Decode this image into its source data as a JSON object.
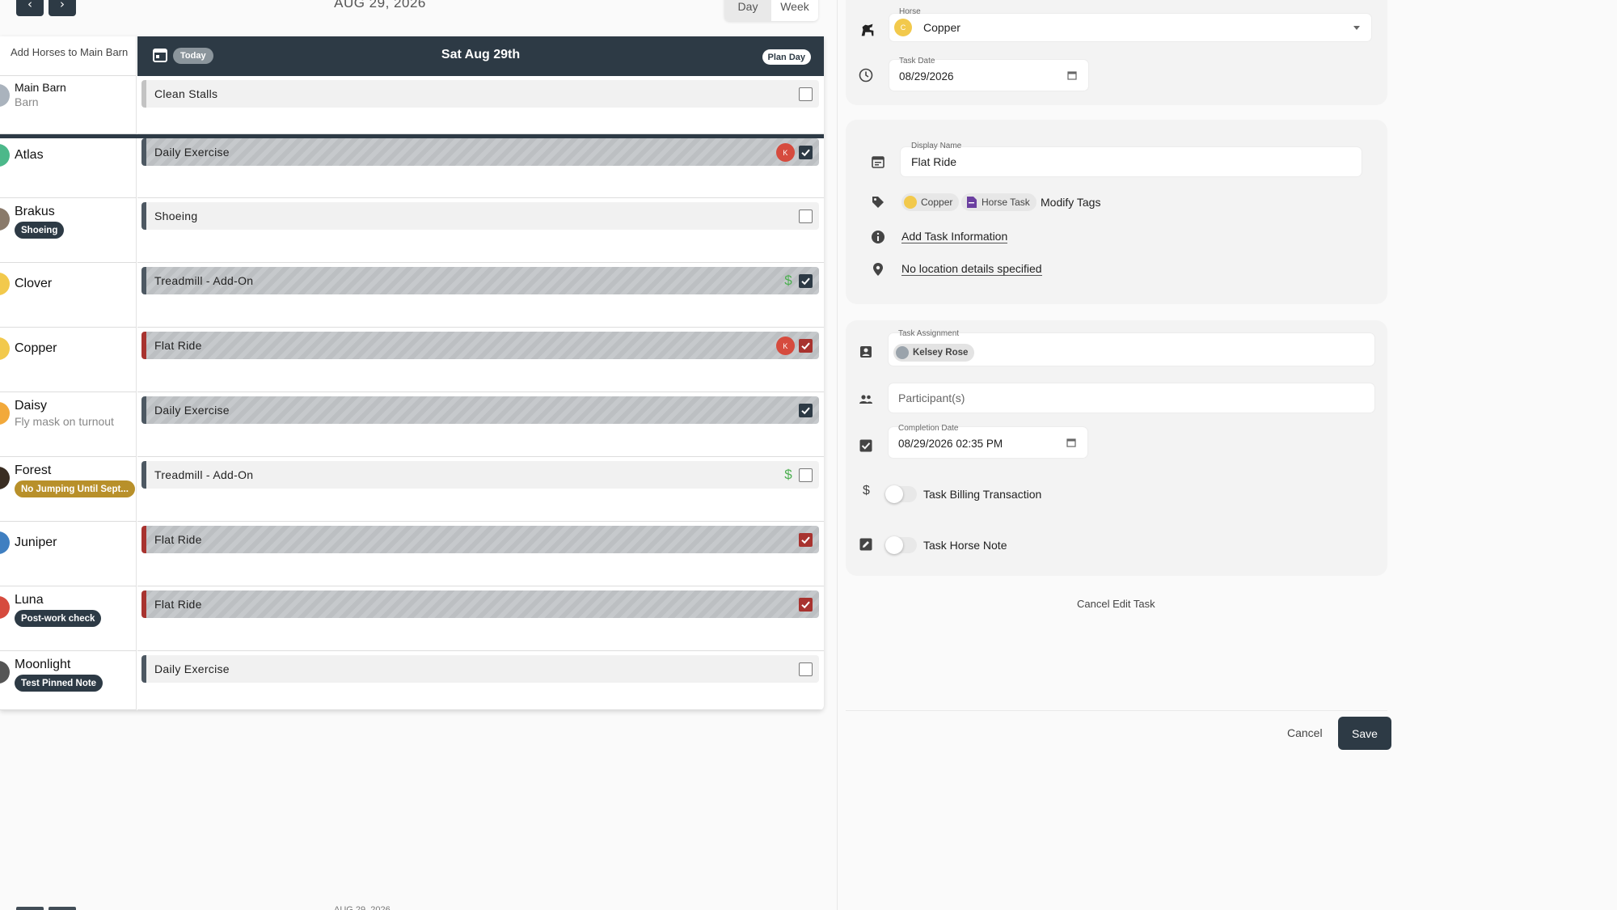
{
  "header": {
    "prev_icon": "chevron-left-icon",
    "next_icon": "chevron-right-icon",
    "date": "AUG 29, 2026",
    "view_day": "Day",
    "view_week": "Week"
  },
  "schedule": {
    "add_horses": "Add Horses to Main Barn",
    "day_label": "Sat Aug 29th",
    "today_label": "Today",
    "plan_day": "Plan Day",
    "rows": [
      {
        "name": "Main Barn",
        "sub": "Barn",
        "avatar_color": "#aab3bd",
        "task": "Clean Stalls",
        "done": false
      },
      {
        "name": "Atlas",
        "avatar_color": "#4cb88a",
        "task": "Daily Exercise",
        "done": true,
        "assignee": "K"
      },
      {
        "name": "Brakus",
        "badge": "Shoeing",
        "badge_color": "#2d3a45",
        "avatar_color": "#8a7a6a",
        "task": "Shoeing",
        "done": false
      },
      {
        "name": "Clover",
        "avatar_color": "#f2c94c",
        "task": "Treadmill - Add-On",
        "done": true,
        "billing": "$"
      },
      {
        "name": "Copper",
        "avatar_color": "#f2c94c",
        "task": "Flat Ride",
        "done": true,
        "assignee": "K"
      },
      {
        "name": "Daisy",
        "sub": "Fly mask on turnout",
        "avatar_color": "#f2a93b",
        "task": "Daily Exercise",
        "done": true
      },
      {
        "name": "Forest",
        "badge": "No Jumping Until Sept...",
        "badge_color": "#b8902a",
        "avatar_color": "#3a2d22",
        "task": "Treadmill - Add-On",
        "done": false,
        "billing": "$"
      },
      {
        "name": "Juniper",
        "avatar_color": "#3f7fc1",
        "task": "Flat Ride",
        "done": true
      },
      {
        "name": "Luna",
        "badge": "Post-work check",
        "badge_color": "#2d3a45",
        "avatar_color": "#d64b3e",
        "task": "Flat Ride",
        "done": true
      },
      {
        "name": "Moonlight",
        "badge": "Test Pinned Note",
        "badge_color": "#2d3a45",
        "avatar_color": "#555555",
        "task": "Daily Exercise",
        "done": false
      }
    ]
  },
  "edit_panel": {
    "horse_label": "Horse",
    "horse_value": "Copper",
    "horse_avatar_letter": "C",
    "task_date_label": "Task Date",
    "task_date_value": "08/29/2026",
    "display_name_label": "Display Name",
    "display_name_value": "Flat Ride",
    "tags": [
      "Copper",
      "Horse Task"
    ],
    "modify_tags": "Modify Tags",
    "add_task_info": "Add Task Information",
    "location": "No location details specified",
    "task_assignment_label": "Task Assignment",
    "assignee": "Kelsey Rose",
    "participants_placeholder": "Participant(s)",
    "completion_date_label": "Completion Date",
    "completion_date_value": "08/29/2026 02:35 PM",
    "billing_toggle": "Task Billing Transaction",
    "note_toggle": "Task Horse Note",
    "cancel_edit": "Cancel Edit Task",
    "cancel": "Cancel",
    "save": "Save"
  },
  "colors": {
    "primary": "#2d3a45",
    "danger": "#a8332f",
    "assignee": "#d64b3e",
    "billing": "#4caf50"
  }
}
